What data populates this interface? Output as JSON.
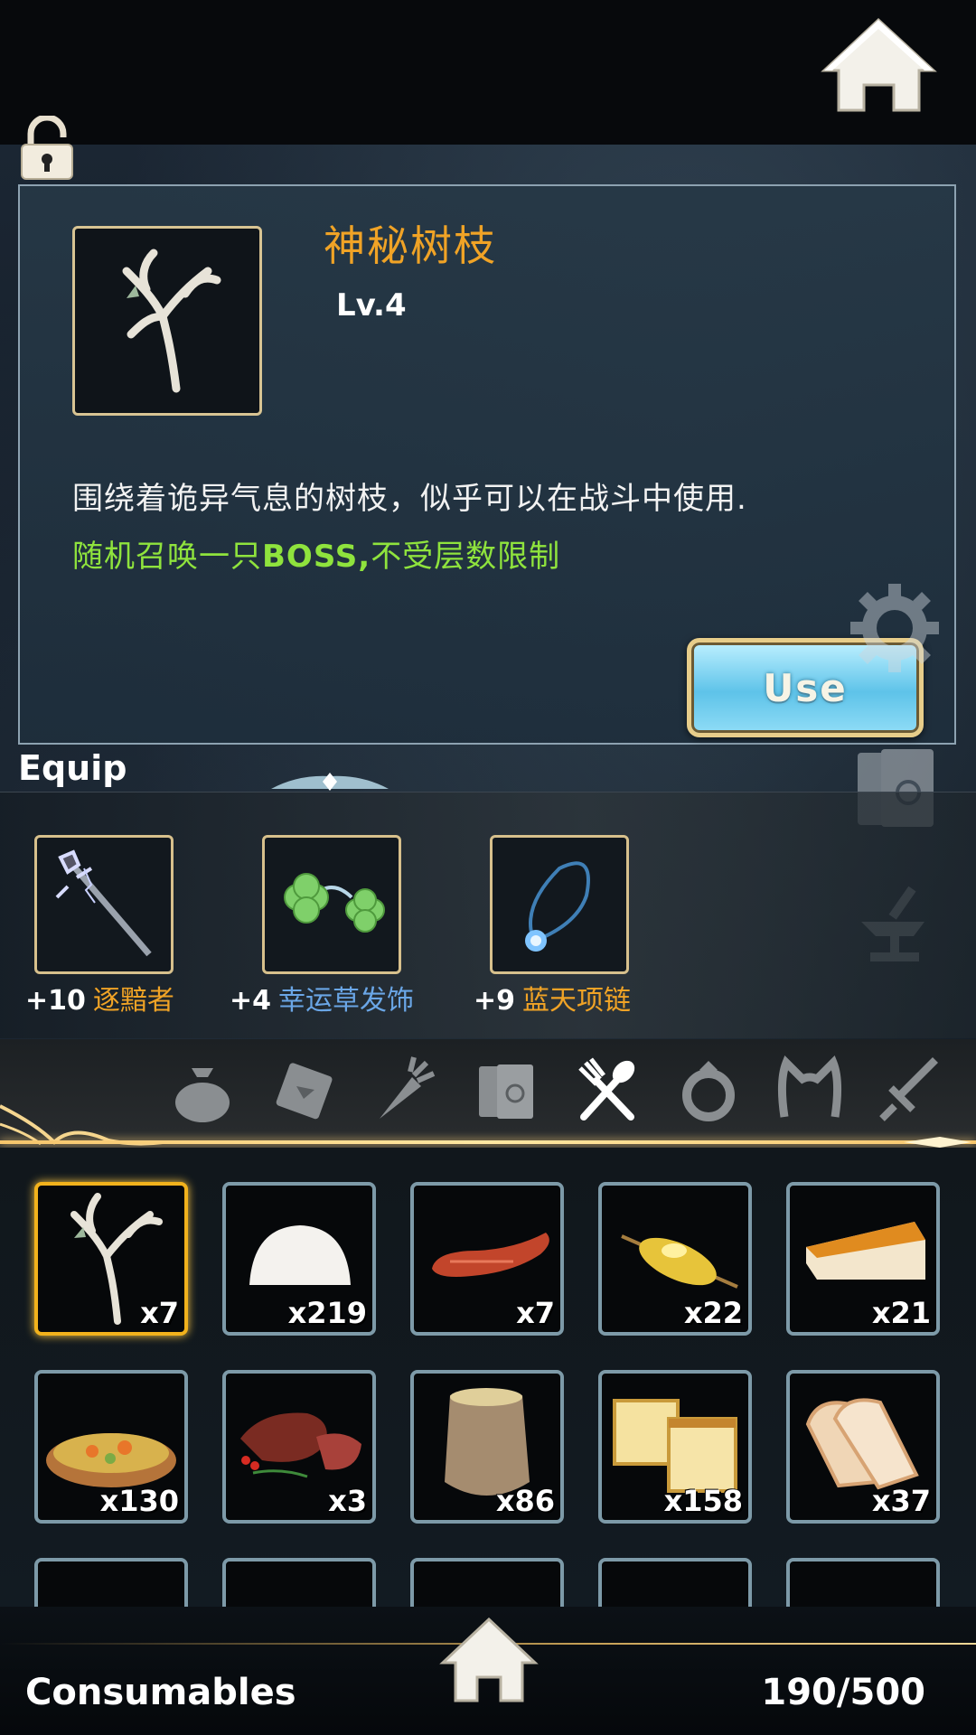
{
  "detail": {
    "name": "神秘树枝",
    "level": "Lv.4",
    "description": "围绕着诡异气息的树枝，似乎可以在战斗中使用.",
    "effect_prefix": "随机召唤一只",
    "effect_bold": "BOSS,",
    "effect_suffix": "不受层数限制",
    "use_label": "Use",
    "name_color": "#f0a326",
    "effect_color": "#8fe33d"
  },
  "equip": {
    "title": "Equip",
    "items": [
      {
        "level": "+10",
        "name": "逐黯者",
        "icon": "staff-icon",
        "color": "#f0a326"
      },
      {
        "level": "+4",
        "name": "幸运草发饰",
        "icon": "clover-icon",
        "color": "#6aa6e6"
      },
      {
        "level": "+9",
        "name": "蓝天项链",
        "icon": "necklace-icon",
        "color": "#f0a326"
      }
    ]
  },
  "tabs": [
    {
      "icon": "bag-icon",
      "active": false
    },
    {
      "icon": "scroll-icon",
      "active": false
    },
    {
      "icon": "carrot-icon",
      "active": false
    },
    {
      "icon": "book-icon",
      "active": false
    },
    {
      "icon": "utensils-icon",
      "active": true
    },
    {
      "icon": "ring-icon",
      "active": false
    },
    {
      "icon": "cat-ears-icon",
      "active": false
    },
    {
      "icon": "sword-icon",
      "active": false
    }
  ],
  "items": [
    {
      "icon": "branch-icon",
      "qty": "x7",
      "selected": true
    },
    {
      "icon": "dumpling-icon",
      "qty": "x219"
    },
    {
      "icon": "sausage-icon",
      "qty": "x7"
    },
    {
      "icon": "corn-icon",
      "qty": "x22"
    },
    {
      "icon": "cheesecake-icon",
      "qty": "x21"
    },
    {
      "icon": "stew-icon",
      "qty": "x130"
    },
    {
      "icon": "steak-icon",
      "qty": "x3"
    },
    {
      "icon": "flour-sack-icon",
      "qty": "x86"
    },
    {
      "icon": "sponge-cake-icon",
      "qty": "x158"
    },
    {
      "icon": "bread-icon",
      "qty": "x37"
    }
  ],
  "footer": {
    "category": "Consumables",
    "capacity": "190/500"
  }
}
